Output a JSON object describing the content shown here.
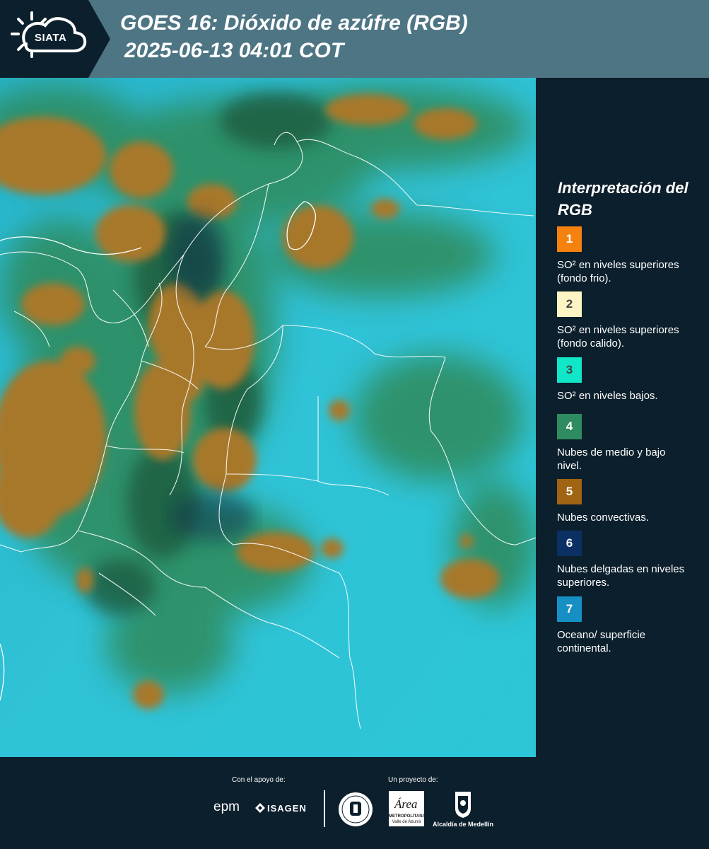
{
  "header": {
    "logo_text": "SIATA",
    "title_line1": "GOES 16: Dióxido de azúfre (RGB)",
    "title_line2": "2025-06-13 04:01 COT",
    "bg_color": "#4e7584"
  },
  "map": {
    "description_icon": "satellite-map",
    "region": "Colombia y alrededores"
  },
  "legend": {
    "title": "Interpretación del RGB",
    "items": [
      {
        "number": "1",
        "color": "#f5820f",
        "label": "SO² en niveles superiores (fondo frio)."
      },
      {
        "number": "2",
        "color": "#fcf5c3",
        "label": "SO² en niveles superiores (fondo calido)."
      },
      {
        "number": "3",
        "color": "#12e6c8",
        "label": "SO² en niveles bajos."
      },
      {
        "number": "4",
        "color": "#2e8c60",
        "label": "Nubes de medio y bajo nivel."
      },
      {
        "number": "5",
        "color": "#a06412",
        "label": "Nubes convectivas."
      },
      {
        "number": "6",
        "color": "#0a3064",
        "label": "Nubes delgadas en niveles superiores."
      },
      {
        "number": "7",
        "color": "#1690c4",
        "label": "Oceano/ superficie continental."
      }
    ]
  },
  "footer": {
    "support_caption": "Con el apoyo de:",
    "project_caption": "Un proyecto de:",
    "sponsor1": "epm",
    "sponsor2": "ISAGEN",
    "area_word": "Área",
    "area_caption1": "METROPOLITANA",
    "area_caption2": "Valle de Aburrá",
    "alcaldia": "Alcaldía de Medellín"
  }
}
